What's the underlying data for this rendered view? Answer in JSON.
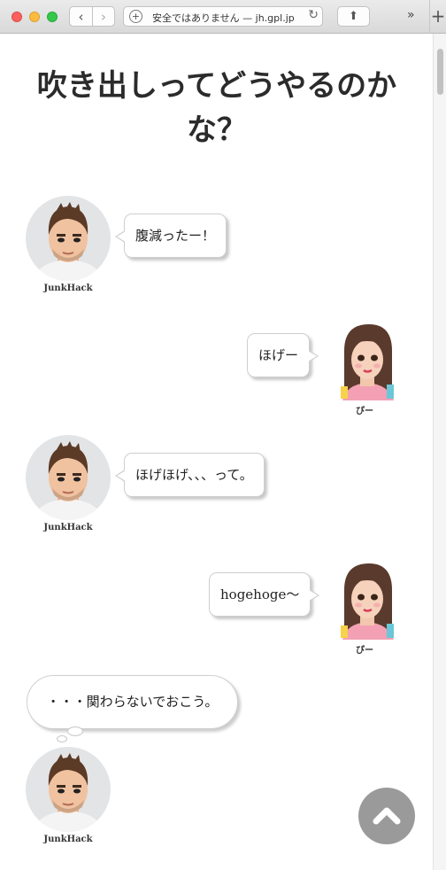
{
  "browser": {
    "back_icon": "chevron-left-icon",
    "forward_icon": "chevron-right-icon",
    "url_text": "安全ではありません — jh.gpl.jp",
    "reload_icon": "reload-icon",
    "share_icon": "share-icon",
    "overflow_glyph": "»",
    "newtab_glyph": "+"
  },
  "page": {
    "title": "吹き出しってどうやるのかな？"
  },
  "speakers": {
    "junkhack": "JunkHack",
    "pi": "ぴー"
  },
  "messages": [
    {
      "speaker": "JunkHack",
      "text": "腹減ったー！",
      "style": "speech-left"
    },
    {
      "speaker": "ぴー",
      "text": "ほげー",
      "style": "speech-right"
    },
    {
      "speaker": "JunkHack",
      "text": "ほげほげ、、、って。",
      "style": "speech-left"
    },
    {
      "speaker": "ぴー",
      "text": "hogehoge〜",
      "style": "speech-right"
    },
    {
      "speaker": "JunkHack",
      "text": "・・・関わらないでおこう。",
      "style": "thought"
    }
  ],
  "scroll_top_icon": "chevron-up-icon",
  "colors": {
    "title": "#2b2b2b",
    "bubble_border": "#cfcfcf",
    "scroll_top_button": "#9a9a9a"
  }
}
